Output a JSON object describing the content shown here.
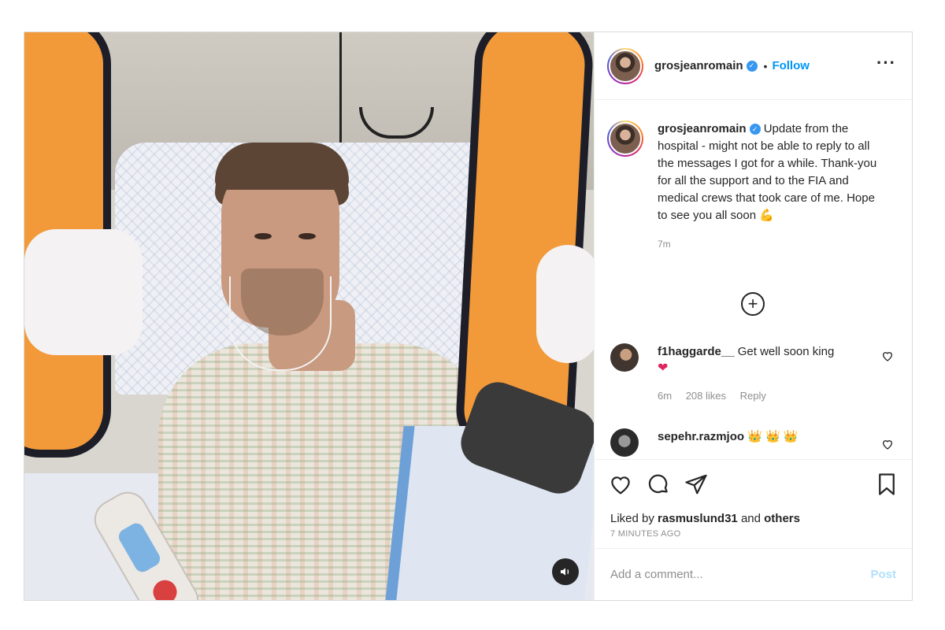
{
  "header": {
    "username": "grosjeanromain",
    "separator": "•",
    "follow_label": "Follow",
    "more_icon": "more-icon"
  },
  "caption": {
    "username": "grosjeanromain",
    "text": "Update from the hospital - might not be able to reply to all the messages I got for a while. Thank-you for all the support and to the FIA and medical crews that took care of me. Hope to see you all soon",
    "emoji": "💪",
    "time": "7m"
  },
  "comments": [
    {
      "username": "f1haggarde__",
      "text": "Get well soon king",
      "emoji": "❤",
      "time": "6m",
      "likes": "208 likes",
      "reply_label": "Reply"
    },
    {
      "username": "sepehr.razmjoo",
      "emoji": "👑 👑 👑"
    }
  ],
  "actions": {
    "liked_by_prefix": "Liked by",
    "liked_by_user": "rasmuslund31",
    "liked_by_and": "and",
    "liked_by_others": "others",
    "ago": "7 MINUTES AGO"
  },
  "add_comment": {
    "placeholder": "Add a comment...",
    "post_label": "Post"
  },
  "colors": {
    "accent": "#0095f6",
    "post_disabled": "#b2dffc",
    "heart": "#e0245e",
    "verified": "#3897f0"
  }
}
